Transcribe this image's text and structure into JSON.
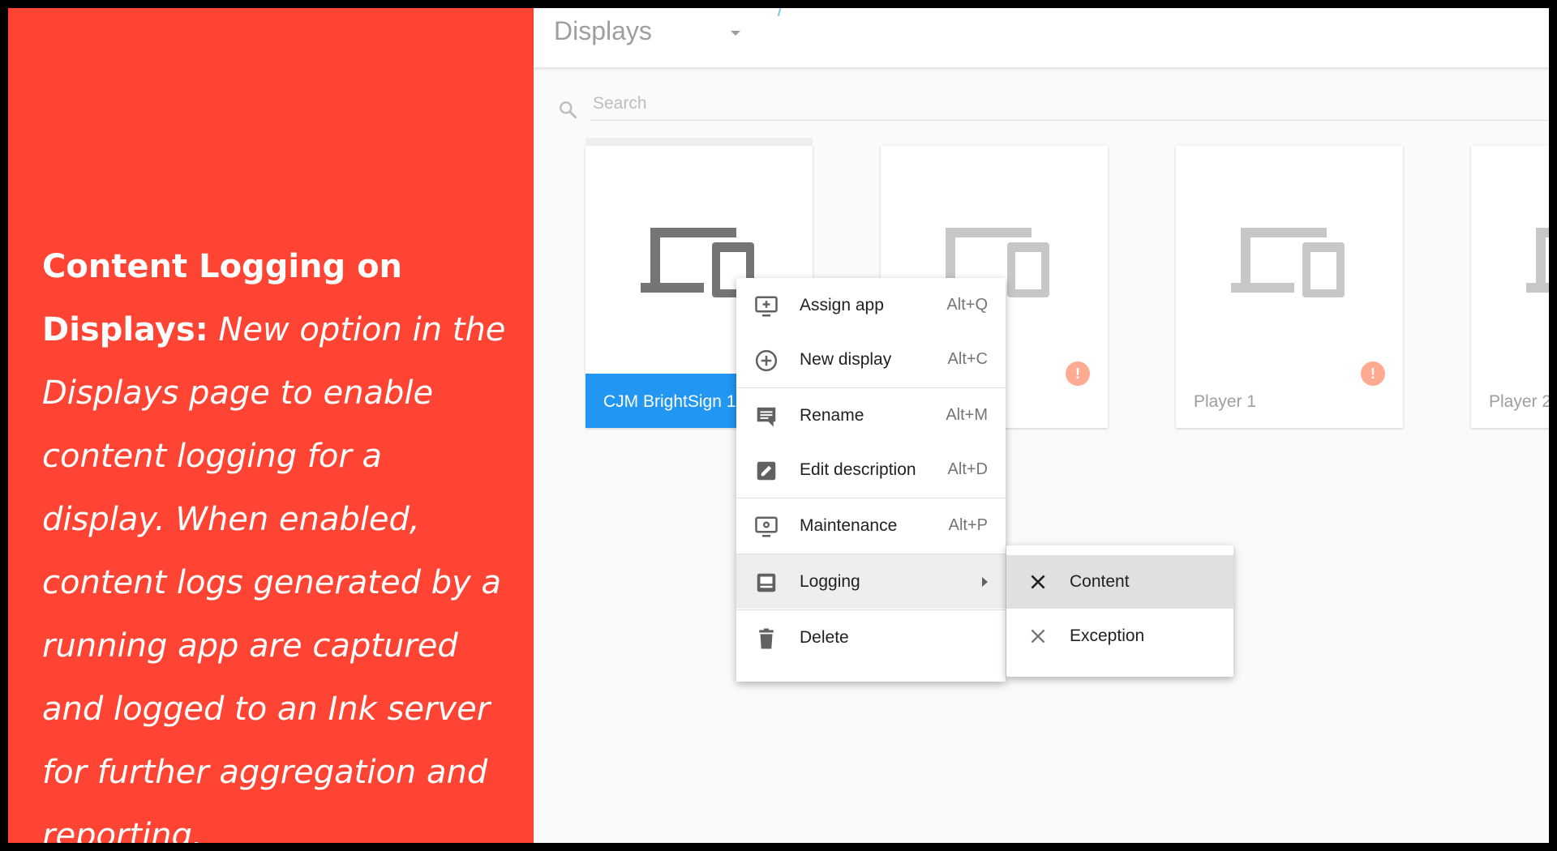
{
  "promo": {
    "heading": "Content Logging on Displays:",
    "body": " New option in the Displays page to enable content logging for a display. When enabled, content logs generated by a running app are captured and logged to an Ink server for further aggregation and reporting."
  },
  "header": {
    "title": "Displays"
  },
  "search": {
    "placeholder": "Search"
  },
  "cards": [
    {
      "name": "CJM BrightSign 1",
      "selected": true,
      "warning": false
    },
    {
      "name": "",
      "selected": false,
      "warning": true
    },
    {
      "name": "Player 1",
      "selected": false,
      "warning": true
    },
    {
      "name": "Player 2",
      "selected": false,
      "warning": false
    }
  ],
  "menu": {
    "items": [
      {
        "label": "Assign app",
        "shortcut": "Alt+Q",
        "icon": "add-to-screen-icon"
      },
      {
        "label": "New display",
        "shortcut": "Alt+C",
        "icon": "add-circle-icon"
      },
      {
        "label": "Rename",
        "shortcut": "Alt+M",
        "icon": "comment-icon"
      },
      {
        "label": "Edit description",
        "shortcut": "Alt+D",
        "icon": "edit-box-icon"
      },
      {
        "label": "Maintenance",
        "shortcut": "Alt+P",
        "icon": "screen-settings-icon"
      },
      {
        "label": "Logging",
        "shortcut": "",
        "icon": "logging-icon"
      },
      {
        "label": "Delete",
        "shortcut": "",
        "icon": "trash-icon"
      }
    ]
  },
  "submenu": {
    "items": [
      {
        "label": "Content",
        "icon": "close-icon"
      },
      {
        "label": "Exception",
        "icon": "close-icon"
      }
    ]
  },
  "colors": {
    "promo_bg": "#ff4433",
    "selected_card": "#2196f3",
    "warning": "#ffab91"
  }
}
